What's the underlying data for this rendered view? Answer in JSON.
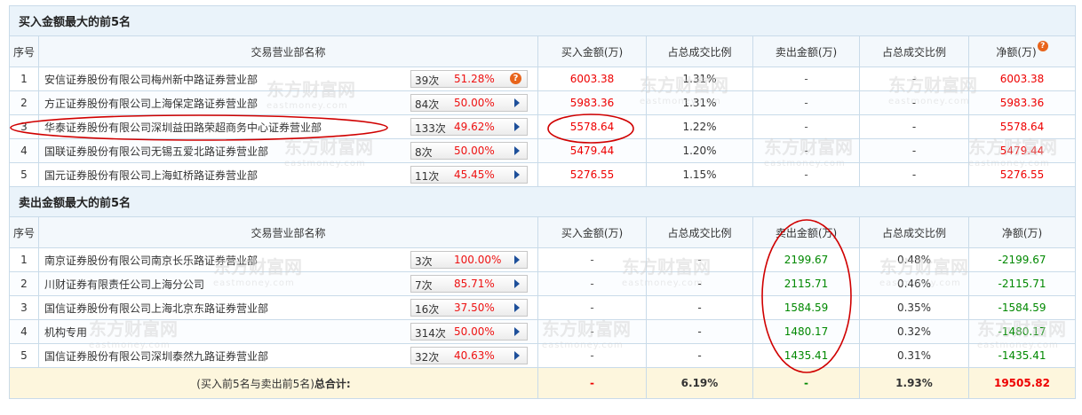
{
  "buy_section": {
    "title": "买入金额最大的前5名",
    "headers": [
      "序号",
      "交易营业部名称",
      "买入金额(万)",
      "占总成交比例",
      "卖出金额(万)",
      "占总成交比例",
      "净额(万)"
    ],
    "rows": [
      {
        "seq": "1",
        "name": "安信证券股份有限公司梅州新中路证券营业部",
        "count": "39次",
        "pct": "51.28%",
        "action_icon": "question-icon",
        "buy": "6003.38",
        "buy_ratio": "1.31%",
        "sell": "-",
        "sell_ratio": "-",
        "net": "6003.38"
      },
      {
        "seq": "2",
        "name": "方正证券股份有限公司上海保定路证券营业部",
        "count": "84次",
        "pct": "50.00%",
        "action_icon": "arrow-right-icon",
        "buy": "5983.36",
        "buy_ratio": "1.31%",
        "sell": "-",
        "sell_ratio": "-",
        "net": "5983.36"
      },
      {
        "seq": "3",
        "name": "华泰证券股份有限公司深圳益田路荣超商务中心证券营业部",
        "count": "133次",
        "pct": "49.62%",
        "action_icon": "arrow-right-icon",
        "buy": "5578.64",
        "buy_ratio": "1.22%",
        "sell": "-",
        "sell_ratio": "-",
        "net": "5578.64"
      },
      {
        "seq": "4",
        "name": "国联证券股份有限公司无锡五爱北路证券营业部",
        "count": "8次",
        "pct": "50.00%",
        "action_icon": "arrow-right-icon",
        "buy": "5479.44",
        "buy_ratio": "1.20%",
        "sell": "-",
        "sell_ratio": "-",
        "net": "5479.44"
      },
      {
        "seq": "5",
        "name": "国元证券股份有限公司上海虹桥路证券营业部",
        "count": "11次",
        "pct": "45.45%",
        "action_icon": "arrow-right-icon",
        "buy": "5276.55",
        "buy_ratio": "1.15%",
        "sell": "-",
        "sell_ratio": "-",
        "net": "5276.55"
      }
    ]
  },
  "sell_section": {
    "title": "卖出金额最大的前5名",
    "headers": [
      "序号",
      "交易营业部名称",
      "买入金额(万)",
      "占总成交比例",
      "卖出金额(万)",
      "占总成交比例",
      "净额(万)"
    ],
    "rows": [
      {
        "seq": "1",
        "name": "南京证券股份有限公司南京长乐路证券营业部",
        "count": "3次",
        "pct": "100.00%",
        "buy": "-",
        "buy_ratio": "-",
        "sell": "2199.67",
        "sell_ratio": "0.48%",
        "net": "-2199.67"
      },
      {
        "seq": "2",
        "name": "川财证券有限责任公司上海分公司",
        "count": "7次",
        "pct": "85.71%",
        "buy": "-",
        "buy_ratio": "-",
        "sell": "2115.71",
        "sell_ratio": "0.46%",
        "net": "-2115.71"
      },
      {
        "seq": "3",
        "name": "国信证券股份有限公司上海北京东路证券营业部",
        "count": "16次",
        "pct": "37.50%",
        "buy": "-",
        "buy_ratio": "-",
        "sell": "1584.59",
        "sell_ratio": "0.35%",
        "net": "-1584.59"
      },
      {
        "seq": "4",
        "name": "机构专用",
        "count": "314次",
        "pct": "50.00%",
        "buy": "-",
        "buy_ratio": "-",
        "sell": "1480.17",
        "sell_ratio": "0.32%",
        "net": "-1480.17"
      },
      {
        "seq": "5",
        "name": "国信证券股份有限公司深圳泰然九路证券营业部",
        "count": "32次",
        "pct": "40.63%",
        "buy": "-",
        "buy_ratio": "-",
        "sell": "1435.41",
        "sell_ratio": "0.31%",
        "net": "-1435.41"
      }
    ]
  },
  "total": {
    "label_prefix": "(买入前5名与卖出前5名)",
    "label_bold": "总合计:",
    "buy": "-",
    "buy_ratio": "6.19%",
    "sell": "-",
    "sell_ratio": "1.93%",
    "net": "19505.82"
  },
  "watermark": {
    "text": "东方财富网",
    "sub": "eastmoney.com"
  },
  "colors": {
    "section_bg": "#eaf3fa",
    "border": "#c9dbe9",
    "up": "#e00000",
    "down": "#008800",
    "total_bg": "#fdf6dd",
    "annotation": "#d00000",
    "icon_orange": "#e8641b"
  }
}
